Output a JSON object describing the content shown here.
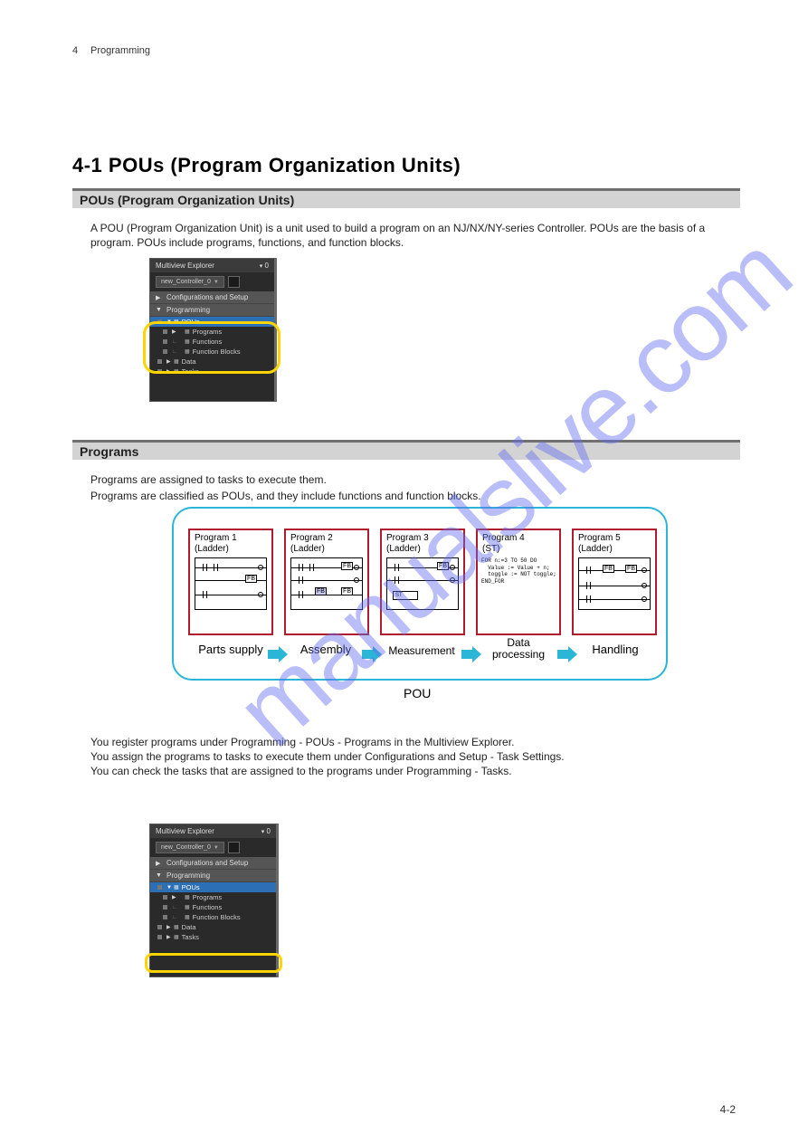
{
  "page": {
    "header_num": "4",
    "header_text": "Programming",
    "section_title": "4-1  POUs (Program Organization Units)",
    "page_num": "4-2"
  },
  "heading1": "POUs (Program Organization Units)",
  "body1": "A POU (Program Organization Unit) is a unit used to build a program on an NJ/NX/NY-series Controller. POUs are the basis of a program. POUs include programs, functions, and function blocks.",
  "heading2": "Programs",
  "body2a": "Programs are assigned to tasks to execute them.",
  "body2b": "Programs are classified as POUs, and they include functions and function blocks.",
  "body3": "You register programs under Programming - POUs - Programs in the Multiview Explorer.\nYou assign the programs to tasks to execute them under Configurations and Setup - Task Settings.\nYou can check the tasks that are assigned to the programs under Programming - Tasks.",
  "explorer1": {
    "title": "Multiview Explorer",
    "badge": "0",
    "device": "new_Controller_0",
    "cat1": "Configurations and Setup",
    "cat2": "Programming",
    "pous": "POUs",
    "programs": "Programs",
    "functions": "Functions",
    "function_blocks": "Function Blocks",
    "data": "Data",
    "tasks": "Tasks"
  },
  "diagram": {
    "programs": [
      {
        "title": "Program 1",
        "lang": "(Ladder)"
      },
      {
        "title": "Program 2",
        "lang": "(Ladder)"
      },
      {
        "title": "Program 3",
        "lang": "(Ladder)"
      },
      {
        "title": "Program 4",
        "lang": "(ST)"
      },
      {
        "title": "Program 5",
        "lang": "(Ladder)"
      }
    ],
    "fb_label": "FB",
    "st_label": "ST",
    "st_code": "FOR n:=3 TO 50 DO\n  Value := Value + n;\n  toggle := NOT toggle;\nEND_FOR",
    "steps": [
      "Parts supply",
      "Assembly",
      "Measurement",
      "Data\nprocessing",
      "Handling"
    ],
    "pou": "POU"
  },
  "explorer2": {
    "title": "Multiview Explorer",
    "badge": "0",
    "device": "new_Controller_0",
    "cat1": "Configurations and Setup",
    "cat2": "Programming",
    "pous": "POUs",
    "programs": "Programs",
    "functions": "Functions",
    "function_blocks": "Function Blocks",
    "data": "Data",
    "tasks": "Tasks"
  }
}
